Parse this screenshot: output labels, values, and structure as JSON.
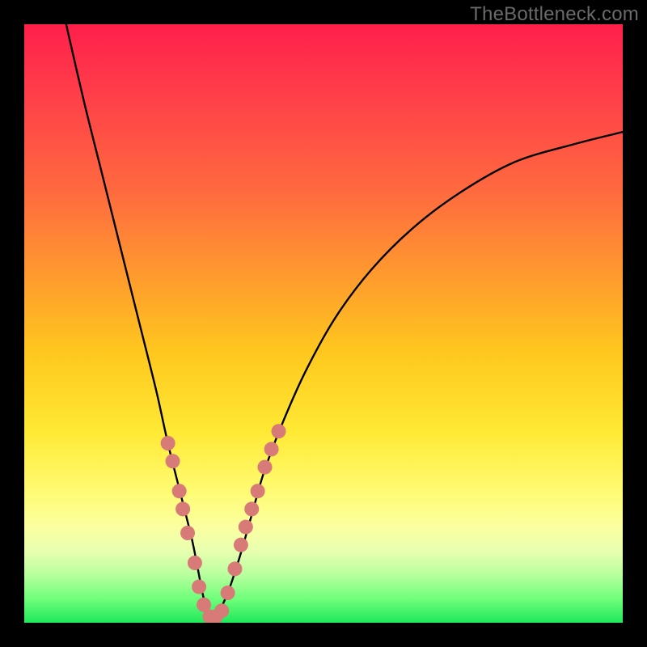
{
  "watermark": "TheBottleneck.com",
  "colors": {
    "frame": "#000000",
    "curve": "#000000",
    "dot_fill": "#d87a78",
    "dot_stroke": "#c86a68",
    "gradient_top": "#ff1f4b",
    "gradient_bottom": "#1fe85b"
  },
  "chart_data": {
    "type": "line",
    "title": "",
    "xlabel": "",
    "ylabel": "",
    "xlim": [
      0,
      100
    ],
    "ylim": [
      0,
      100
    ],
    "note": "y is percent bottleneck (0 at bottom / green, 100 at top / red). V-shaped curve with minimum near x≈31.",
    "series": [
      {
        "name": "bottleneck-curve",
        "x": [
          7,
          10,
          13,
          16,
          19,
          22,
          24,
          26,
          28,
          29,
          30,
          31,
          32,
          34,
          36,
          38,
          40,
          43,
          47,
          52,
          58,
          65,
          73,
          82,
          92,
          100
        ],
        "y": [
          100,
          87,
          75,
          63,
          51,
          39,
          30,
          22,
          14,
          9,
          4,
          1,
          1,
          5,
          11,
          18,
          25,
          33,
          42,
          51,
          59,
          66,
          72,
          77,
          80,
          82
        ]
      }
    ],
    "dots": {
      "name": "highlight-dots",
      "note": "pink dots clustered on both sides of the minimum, roughly y≤30",
      "points": [
        {
          "x": 24.0,
          "y": 30
        },
        {
          "x": 24.8,
          "y": 27
        },
        {
          "x": 25.9,
          "y": 22
        },
        {
          "x": 26.5,
          "y": 19
        },
        {
          "x": 27.3,
          "y": 15
        },
        {
          "x": 28.5,
          "y": 10
        },
        {
          "x": 29.2,
          "y": 6
        },
        {
          "x": 30.0,
          "y": 3
        },
        {
          "x": 31.0,
          "y": 1
        },
        {
          "x": 32.0,
          "y": 1
        },
        {
          "x": 33.0,
          "y": 2
        },
        {
          "x": 34.0,
          "y": 5
        },
        {
          "x": 35.2,
          "y": 9
        },
        {
          "x": 36.2,
          "y": 13
        },
        {
          "x": 37.0,
          "y": 16
        },
        {
          "x": 38.0,
          "y": 19
        },
        {
          "x": 39.0,
          "y": 22
        },
        {
          "x": 40.2,
          "y": 26
        },
        {
          "x": 41.3,
          "y": 29
        },
        {
          "x": 42.5,
          "y": 32
        }
      ]
    }
  }
}
